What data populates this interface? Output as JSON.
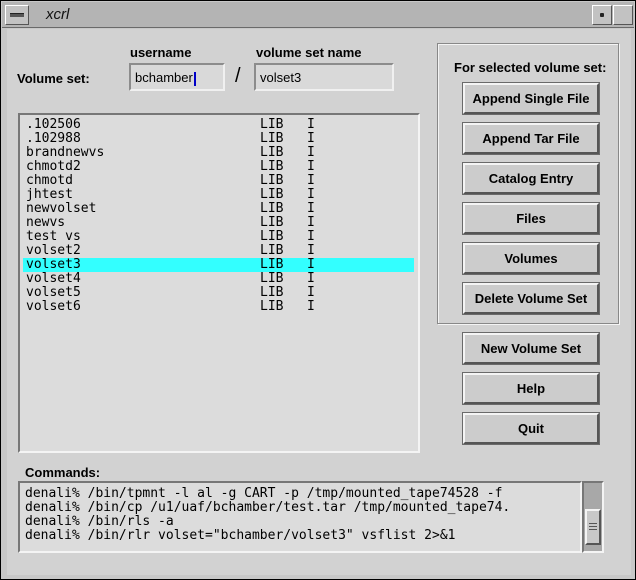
{
  "window": {
    "title": "xcrl"
  },
  "labels": {
    "username": "username",
    "volume_set_name": "volume set name",
    "volume_set": "Volume set:",
    "group_title": "For selected volume set:",
    "commands": "Commands:"
  },
  "fields": {
    "username": "bchamber",
    "volume_set_name": "volset3",
    "separator": "/"
  },
  "volume_sets": [
    {
      "name": ".102506",
      "type": "LIB",
      "mode": "I",
      "selected": false
    },
    {
      "name": ".102988",
      "type": "LIB",
      "mode": "I",
      "selected": false
    },
    {
      "name": "brandnewvs",
      "type": "LIB",
      "mode": "I",
      "selected": false
    },
    {
      "name": "chmotd2",
      "type": "LIB",
      "mode": "I",
      "selected": false
    },
    {
      "name": "chmotd",
      "type": "LIB",
      "mode": "I",
      "selected": false
    },
    {
      "name": "jhtest",
      "type": "LIB",
      "mode": "I",
      "selected": false
    },
    {
      "name": "newvolset",
      "type": "LIB",
      "mode": "I",
      "selected": false
    },
    {
      "name": "newvs",
      "type": "LIB",
      "mode": "I",
      "selected": false
    },
    {
      "name": "test vs",
      "type": "LIB",
      "mode": "I",
      "selected": false
    },
    {
      "name": "volset2",
      "type": "LIB",
      "mode": "I",
      "selected": false
    },
    {
      "name": "volset3",
      "type": "LIB",
      "mode": "I",
      "selected": true
    },
    {
      "name": "volset4",
      "type": "LIB",
      "mode": "I",
      "selected": false
    },
    {
      "name": "volset5",
      "type": "LIB",
      "mode": "I",
      "selected": false
    },
    {
      "name": "volset6",
      "type": "LIB",
      "mode": "I",
      "selected": false
    }
  ],
  "buttons": {
    "append_single_file": "Append Single File",
    "append_tar_file": "Append Tar File",
    "catalog_entry": "Catalog Entry",
    "files": "Files",
    "volumes": "Volumes",
    "delete_volume_set": "Delete Volume Set",
    "new_volume_set": "New Volume Set",
    "help": "Help",
    "quit": "Quit"
  },
  "commands": [
    "denali% /bin/tpmnt -l al -g CART -p /tmp/mounted_tape74528 -f",
    "denali% /bin/cp /u1/uaf/bchamber/test.tar /tmp/mounted_tape74.",
    "denali% /bin/rls -a",
    "denali% /bin/rlr volset=\"bchamber/volset3\" vsflist 2>&1"
  ],
  "colors": {
    "selection": "#33ffff",
    "background": "#d2d2d2"
  }
}
